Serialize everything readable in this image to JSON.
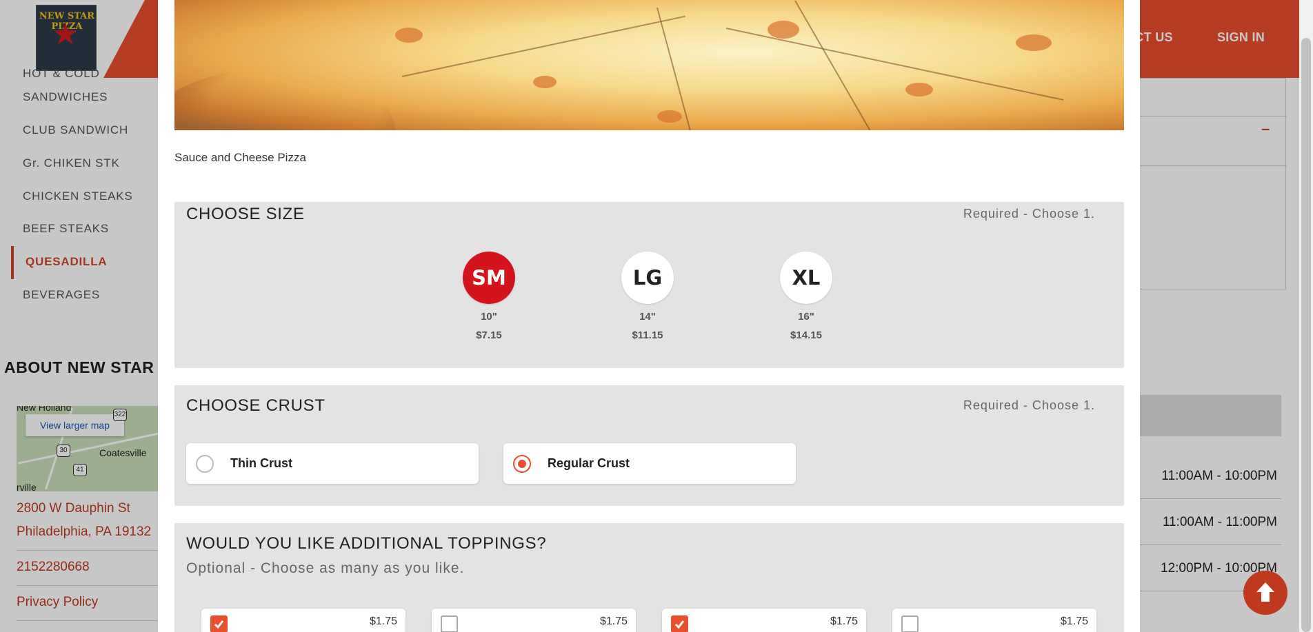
{
  "colors": {
    "brand": "#e84f2f",
    "accent_red": "#d3141c",
    "link": "#c0391f"
  },
  "header": {
    "logo_text": "NEW STAR PIZZA",
    "nav": [
      "CONTACT US",
      "SIGN IN"
    ],
    "nav_visible": [
      "ACT US",
      "SIGN IN"
    ]
  },
  "sidebar": {
    "items": [
      {
        "label": "HOT & COLD"
      },
      {
        "label": "SANDWICHES"
      },
      {
        "label": "CLUB SANDWICH"
      },
      {
        "label": "Gr. CHIKEN STK"
      },
      {
        "label": "CHICKEN STEAKS"
      },
      {
        "label": "BEEF STEAKS"
      },
      {
        "label": "QUESADILLA",
        "active": true
      },
      {
        "label": "BEVERAGES"
      }
    ]
  },
  "about": {
    "title": "ABOUT NEW STAR P",
    "map_button": "View larger map",
    "map_labels": [
      "New Holland",
      "Coatesville",
      "rville"
    ],
    "map_shields": [
      "30",
      "41",
      "322"
    ],
    "address_line1": "2800 W Dauphin St",
    "address_line2": "Philadelphia, PA 19132",
    "phone": "2152280668",
    "privacy": "Privacy Policy"
  },
  "hours": [
    "11:00AM - 10:00PM",
    "11:00AM - 11:00PM",
    "12:00PM - 10:00PM"
  ],
  "modal": {
    "description": "Sauce and Cheese Pizza",
    "size_section": {
      "title": "CHOOSE SIZE",
      "requirement": "Required - Choose 1.",
      "options": [
        {
          "code": "SM",
          "inches": "10\"",
          "price": "$7.15",
          "selected": true
        },
        {
          "code": "LG",
          "inches": "14\"",
          "price": "$11.15",
          "selected": false
        },
        {
          "code": "XL",
          "inches": "16\"",
          "price": "$14.15",
          "selected": false
        }
      ]
    },
    "crust_section": {
      "title": "CHOOSE CRUST",
      "requirement": "Required - Choose 1.",
      "options": [
        {
          "label": "Thin Crust",
          "selected": false
        },
        {
          "label": "Regular Crust",
          "selected": true
        }
      ]
    },
    "toppings_section": {
      "title": "WOULD YOU LIKE ADDITIONAL TOPPINGS?",
      "subtitle": "Optional - Choose as many as you like.",
      "items": [
        {
          "price": "$1.75",
          "checked": true
        },
        {
          "price": "$1.75",
          "checked": false
        },
        {
          "price": "$1.75",
          "checked": true
        },
        {
          "price": "$1.75",
          "checked": false
        }
      ]
    }
  }
}
